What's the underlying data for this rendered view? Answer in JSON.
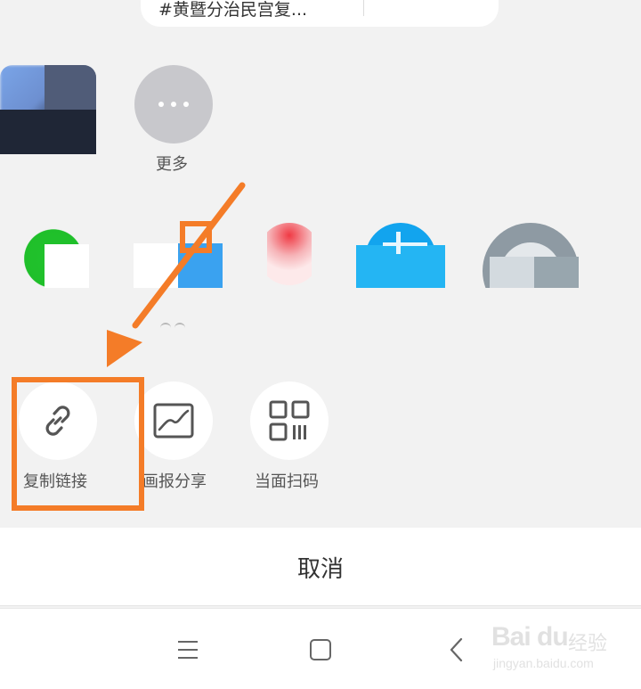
{
  "share_sheet": {
    "pinned_chat_preview": "#黄暨分治民宫复...",
    "more_label": "更多",
    "actions": [
      {
        "label": "复制链接",
        "icon": "link-icon"
      },
      {
        "label": "画报分享",
        "icon": "image-icon"
      },
      {
        "label": "当面扫码",
        "icon": "qr-code-icon"
      }
    ],
    "cancel_label": "取消"
  },
  "annotation": {
    "color": "#f47c28",
    "highlight_target": "复制链接"
  },
  "nav_bar": {
    "buttons": [
      "menu-icon",
      "home-icon",
      "back-icon"
    ]
  },
  "watermark": {
    "logo": "Bai du",
    "cn": "经验",
    "url": "jingyan.baidu.com"
  }
}
